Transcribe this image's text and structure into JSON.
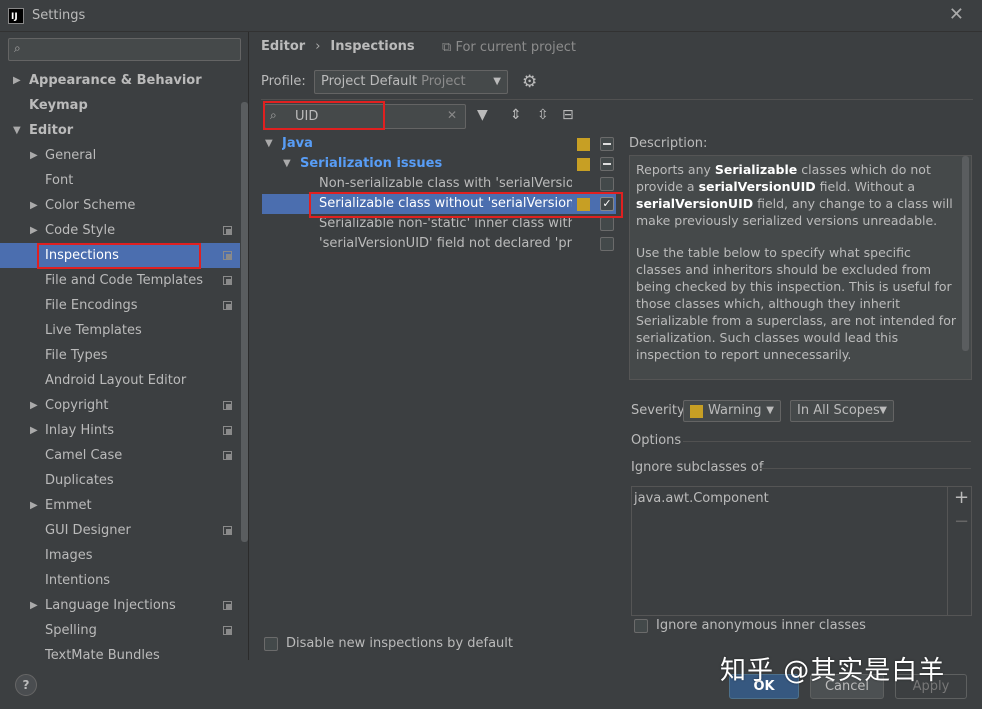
{
  "window": {
    "title": "Settings",
    "app_icon": "IJ",
    "close_glyph": "✕"
  },
  "left": {
    "search_placeholder": "",
    "items": [
      {
        "label": "Appearance & Behavior",
        "level": 0,
        "arrow": "▶",
        "bold": true
      },
      {
        "label": "Keymap",
        "level": 0,
        "arrow": "",
        "bold": true
      },
      {
        "label": "Editor",
        "level": 0,
        "arrow": "▼",
        "bold": true
      },
      {
        "label": "General",
        "level": 1,
        "arrow": "▶"
      },
      {
        "label": "Font",
        "level": 1,
        "arrow": ""
      },
      {
        "label": "Color Scheme",
        "level": 1,
        "arrow": "▶"
      },
      {
        "label": "Code Style",
        "level": 1,
        "arrow": "▶",
        "copy": true
      },
      {
        "label": "Inspections",
        "level": 1,
        "arrow": "",
        "copy": true,
        "selected": true
      },
      {
        "label": "File and Code Templates",
        "level": 1,
        "arrow": "",
        "copy": true
      },
      {
        "label": "File Encodings",
        "level": 1,
        "arrow": "",
        "copy": true
      },
      {
        "label": "Live Templates",
        "level": 1,
        "arrow": ""
      },
      {
        "label": "File Types",
        "level": 1,
        "arrow": ""
      },
      {
        "label": "Android Layout Editor",
        "level": 1,
        "arrow": ""
      },
      {
        "label": "Copyright",
        "level": 1,
        "arrow": "▶",
        "copy": true
      },
      {
        "label": "Inlay Hints",
        "level": 1,
        "arrow": "▶",
        "copy": true
      },
      {
        "label": "Camel Case",
        "level": 1,
        "arrow": "",
        "copy": true
      },
      {
        "label": "Duplicates",
        "level": 1,
        "arrow": ""
      },
      {
        "label": "Emmet",
        "level": 1,
        "arrow": "▶"
      },
      {
        "label": "GUI Designer",
        "level": 1,
        "arrow": "",
        "copy": true
      },
      {
        "label": "Images",
        "level": 1,
        "arrow": ""
      },
      {
        "label": "Intentions",
        "level": 1,
        "arrow": ""
      },
      {
        "label": "Language Injections",
        "level": 1,
        "arrow": "▶",
        "copy": true
      },
      {
        "label": "Spelling",
        "level": 1,
        "arrow": "",
        "copy": true
      },
      {
        "label": "TextMate Bundles",
        "level": 1,
        "arrow": ""
      }
    ]
  },
  "breadcrumb": {
    "root": "Editor",
    "separator": "›",
    "current": "Inspections",
    "scope_note": "For current project"
  },
  "profile": {
    "label": "Profile:",
    "value": "Project Default",
    "sub": "Project"
  },
  "filter": {
    "value": "UID"
  },
  "inspections": [
    {
      "label": "Java",
      "level": 0,
      "arrow": "▼",
      "group": true,
      "state": "minus"
    },
    {
      "label": "Serialization issues",
      "level": 1,
      "arrow": "▼",
      "group": true,
      "state": "minus"
    },
    {
      "label": "Non-serializable class with 'serialVersionUID'",
      "level": 2,
      "state": "off"
    },
    {
      "label": "Serializable class without 'serialVersionUID'",
      "level": 2,
      "state": "on",
      "selected": true
    },
    {
      "label": "Serializable non-'static' inner class without 'serialVersionUID'",
      "level": 2,
      "state": "off"
    },
    {
      "label": "'serialVersionUID' field not declared 'private static final long'",
      "level": 2,
      "state": "off"
    }
  ],
  "disable_new": "Disable new inspections by default",
  "description": {
    "title": "Description:",
    "p1": [
      {
        "t": "Reports any ",
        "b": false
      },
      {
        "t": "Serializable",
        "b": true
      },
      {
        "t": " classes which do not provide a ",
        "b": false
      },
      {
        "t": "serialVersionUID",
        "b": true
      },
      {
        "t": " field. Without a ",
        "b": false
      },
      {
        "t": "serialVersionUID",
        "b": true
      },
      {
        "t": " field, any change to a class will make previously serialized versions unreadable.",
        "b": false
      }
    ],
    "p2": "Use the table below to specify what specific classes and inheritors should be excluded from being checked by this inspection. This is useful for those classes which, although they inherit Serializable from a superclass, are not intended for serialization. Such classes would lead this inspection to report unnecessarily."
  },
  "severity": {
    "label": "Severity:",
    "value": "Warning",
    "scope": "In All Scopes"
  },
  "options": {
    "title": "Options",
    "ignore_subclasses": "Ignore subclasses of",
    "list": [
      "java.awt.Component"
    ],
    "anon": "Ignore anonymous inner classes"
  },
  "buttons": {
    "help": "?",
    "ok": "OK",
    "cancel": "Cancel",
    "apply": "Apply"
  },
  "watermark": "知乎 @其实是白羊",
  "colors": {
    "accent": "#4b6eaf",
    "warning": "#c79f24",
    "highlight": "#e02020"
  }
}
